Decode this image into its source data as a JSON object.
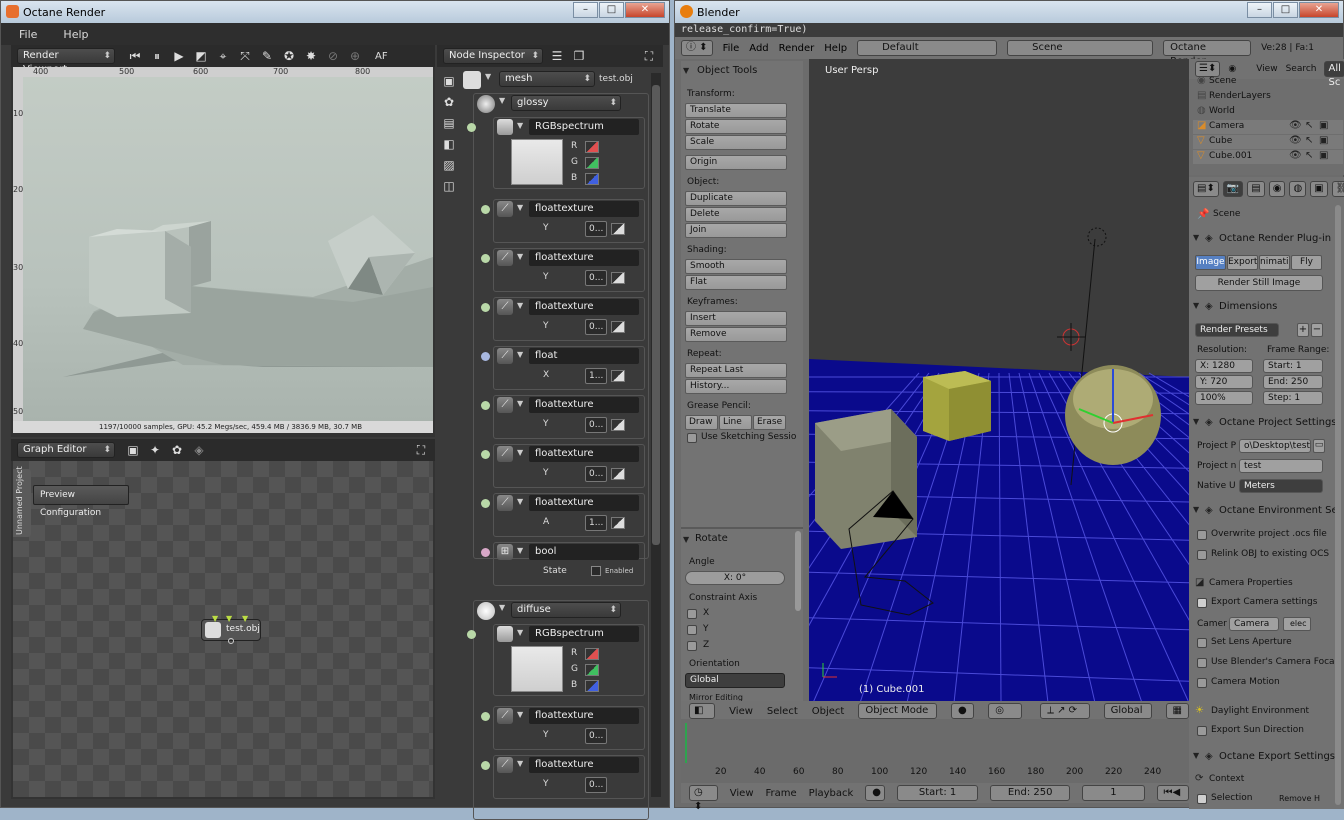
{
  "octane": {
    "title": "Octane Render",
    "menu": [
      "File",
      "Help"
    ],
    "viewport_header": {
      "mode": "Render Viewport",
      "af": "AF"
    },
    "ruler_top": [
      "400",
      "500",
      "600",
      "700",
      "800"
    ],
    "ruler_left": [
      "100",
      "200",
      "300",
      "400",
      "500"
    ],
    "status_text": "1197/10000 samples, GPU: 45.2 Megs/sec, 459.4 MB / 3836.9 MB, 30.7 MB",
    "graph_header": "Graph Editor",
    "project_tab": "Unnamed Project",
    "preview_config": "Preview Configuration",
    "graph_node": "test.obj",
    "inspector": {
      "title": "Node Inspector",
      "mesh_combo": "mesh",
      "mesh_name": "test.obj",
      "glossy": "glossy",
      "rgb1": "RGBspectrum",
      "rgb_labels": [
        "R",
        "G",
        "B"
      ],
      "float_nodes": [
        {
          "name": "floattexture",
          "param": "Y",
          "value": "0..."
        },
        {
          "name": "floattexture",
          "param": "Y",
          "value": "0..."
        },
        {
          "name": "floattexture",
          "param": "Y",
          "value": "0..."
        },
        {
          "name": "float",
          "param": "X",
          "value": "1..."
        },
        {
          "name": "floattexture",
          "param": "Y",
          "value": "0..."
        },
        {
          "name": "floattexture",
          "param": "Y",
          "value": "0..."
        },
        {
          "name": "floattexture",
          "param": "A",
          "value": "1..."
        }
      ],
      "bool_node": "bool",
      "bool_state": "State",
      "bool_enabled": "Enabled",
      "diffuse": "diffuse",
      "rgb2": "RGBspectrum",
      "diffuse_floats": [
        {
          "name": "floattexture",
          "param": "Y",
          "value": "0..."
        },
        {
          "name": "floattexture",
          "param": "Y",
          "value": "0..."
        }
      ]
    }
  },
  "blender": {
    "title": "Blender",
    "console": "release_confirm=True)",
    "menu": [
      "File",
      "Add",
      "Render",
      "Help"
    ],
    "layout": "Default",
    "scene": "Scene",
    "engine": "Octane Render",
    "stats": "Ve:28 | Fa:1",
    "tools": {
      "title": "Object Tools",
      "transform": "Transform:",
      "transform_btns": [
        "Translate",
        "Rotate",
        "Scale"
      ],
      "origin": "Origin",
      "object": "Object:",
      "object_btns": [
        "Duplicate",
        "Delete",
        "Join"
      ],
      "shading": "Shading:",
      "shading_btns": [
        "Smooth",
        "Flat"
      ],
      "keyframes": "Keyframes:",
      "keyframe_btns": [
        "Insert",
        "Remove"
      ],
      "repeat": "Repeat:",
      "repeat_btns": [
        "Repeat Last",
        "History..."
      ],
      "grease": "Grease Pencil:",
      "grease_btns": [
        "Draw",
        "Line",
        "Erase"
      ],
      "sketching": "Use Sketching Sessio",
      "rotate_title": "Rotate",
      "angle": "Angle",
      "angle_val": "X: 0°",
      "constraint": "Constraint Axis",
      "axes": [
        "X",
        "Y",
        "Z"
      ],
      "orientation": "Orientation",
      "orientation_val": "Global",
      "mirror": "Mirror Editing"
    },
    "view3d": {
      "label": "User Persp",
      "object": "(1) Cube.001"
    },
    "view_header": {
      "items": [
        "View",
        "Select",
        "Object"
      ],
      "mode": "Object Mode",
      "orient": "Global"
    },
    "outliner": {
      "view": "View",
      "search": "Search",
      "all": "All Sc",
      "items": [
        "Scene",
        "RenderLayers",
        "World",
        "Camera",
        "Cube",
        "Cube.001"
      ]
    },
    "props": {
      "scene": "Scene",
      "plugin": "Octane Render Plug-in",
      "tabs": [
        "Image",
        "Export",
        "nimatio",
        "Fly"
      ],
      "render_still": "Render Still Image",
      "dimensions": "Dimensions",
      "presets": "Render Presets",
      "resolution": "Resolution:",
      "frame_range": "Frame Range:",
      "res_x": "X: 1280",
      "res_y": "Y: 720",
      "res_pct": "100%",
      "start": "Start: 1",
      "end": "End: 250",
      "step": "Step: 1",
      "project_settings": "Octane Project Settings",
      "project_p": "Project P",
      "project_p_val": "o\\Desktop\\test\\",
      "project_n": "Project n",
      "project_n_val": "test",
      "native_u": "Native U",
      "native_u_val": "Meters",
      "env_settings": "Octane Environment Se",
      "overwrite": "Overwrite project .ocs file",
      "relink": "Relink OBJ to existing OCS",
      "camera_props": "Camera Properties",
      "export_camera": "Export Camera settings",
      "camer": "Camer",
      "camer_val": "Camera",
      "selec": "elec",
      "lens": "Set Lens Aperture",
      "blender_focal": "Use Blender's Camera Foca",
      "camera_motion": "Camera Motion",
      "daylight": "Daylight Environment",
      "sun": "Export Sun Direction",
      "export_settings": "Octane Export Settings",
      "context": "Context",
      "selection": "Selection",
      "remove": "Remove H"
    },
    "timeline": {
      "ticks": [
        "20",
        "40",
        "60",
        "80",
        "100",
        "120",
        "140",
        "160",
        "180",
        "200",
        "220",
        "240"
      ],
      "menu": [
        "View",
        "Frame",
        "Playback"
      ],
      "start": "Start: 1",
      "end": "End: 250",
      "current": "1"
    }
  }
}
